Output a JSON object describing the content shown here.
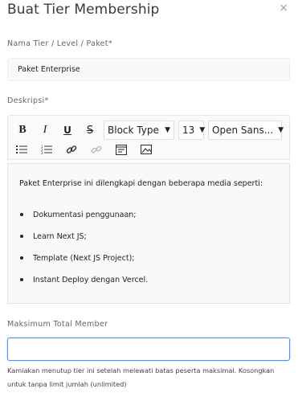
{
  "modal": {
    "title": "Buat Tier Membership",
    "close_icon": "close-icon"
  },
  "form": {
    "name": {
      "label": "Nama Tier / Level / Paket*",
      "value": "Paket Enterprise"
    },
    "description": {
      "label": "Deskripsi*",
      "toolbar": {
        "bold": "B",
        "italic": "I",
        "underline": "U",
        "strike": "S",
        "block_type": "Block Type",
        "font_size": "13",
        "font_family": "Open Sans...",
        "icons": [
          "unordered-list-icon",
          "ordered-list-icon",
          "link-icon",
          "unlink-icon",
          "embed-icon",
          "image-icon"
        ]
      },
      "content": {
        "paragraph": "Paket Enterprise ini dilengkapi dengan beberapa media seperti:",
        "items": [
          "Dokumentasi penggunaan;",
          "Learn Next JS;",
          "Template (Next JS Project);",
          "Instant Deploy dengan Vercel."
        ]
      }
    },
    "max_member": {
      "label": "Maksimum Total Member",
      "value": "",
      "help": "Kamiakan menutup tier ini setelah melewati batas peserta maksimal. Kosongkan untuk tanpa limit jumlah (unlimited)"
    }
  },
  "colors": {
    "focus_border": "#4d90fe",
    "field_bg": "#f8f9fa"
  }
}
